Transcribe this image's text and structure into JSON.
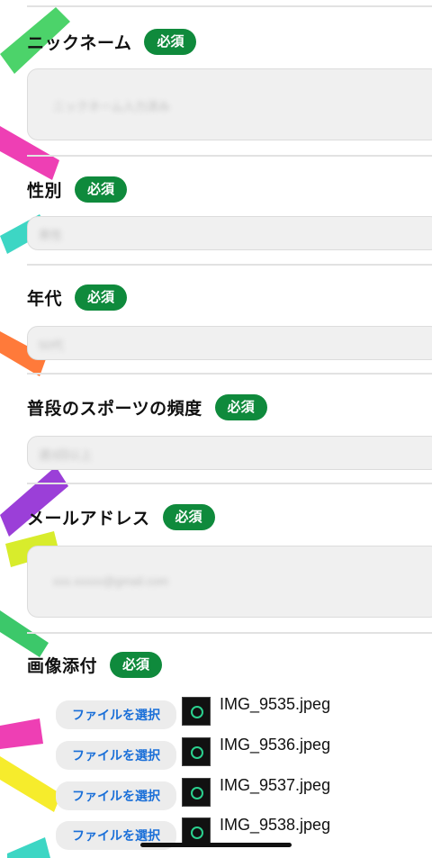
{
  "required_label": "必須",
  "fields": {
    "nickname": {
      "label": "ニックネーム",
      "value": "ニックネーム入力済み"
    },
    "gender": {
      "label": "性別",
      "value": "男性"
    },
    "age": {
      "label": "年代",
      "value": "50代"
    },
    "sports": {
      "label": "普段のスポーツの頻度",
      "value": "週3回以上"
    },
    "email": {
      "label": "メールアドレス",
      "value": "xxx.xxxxx@gmail.com"
    }
  },
  "images": {
    "label": "画像添付",
    "button_label": "ファイルを選択",
    "files": [
      "IMG_9535.jpeg",
      "IMG_9536.jpeg",
      "IMG_9537.jpeg",
      "IMG_9538.jpeg"
    ]
  },
  "colors": {
    "badge": "#0f8a3c",
    "file_button_text": "#1a6fd8"
  }
}
